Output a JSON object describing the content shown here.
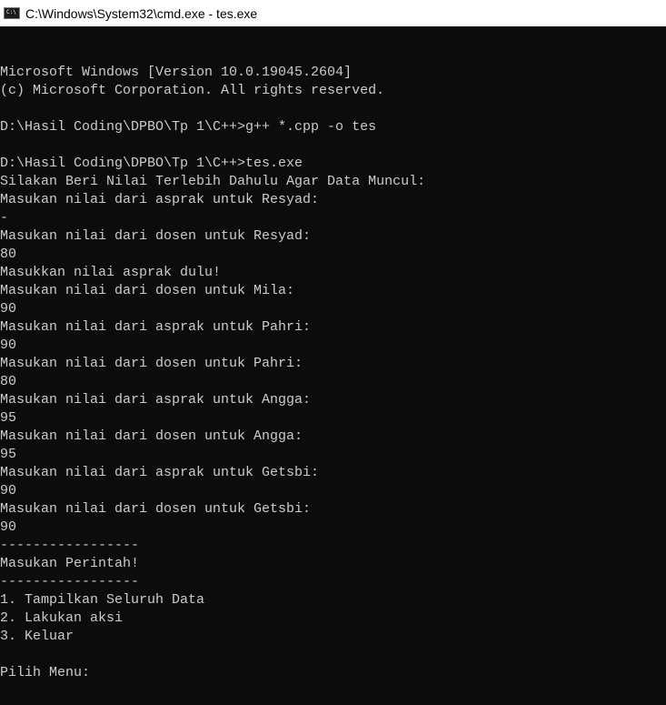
{
  "window": {
    "title": "C:\\Windows\\System32\\cmd.exe - tes.exe",
    "icon": "cmd-icon",
    "icon_text": "C:\\"
  },
  "console": {
    "lines": [
      "Microsoft Windows [Version 10.0.19045.2604]",
      "(c) Microsoft Corporation. All rights reserved.",
      "",
      "D:\\Hasil Coding\\DPBO\\Tp 1\\C++>g++ *.cpp -o tes",
      "",
      "D:\\Hasil Coding\\DPBO\\Tp 1\\C++>tes.exe",
      "Silakan Beri Nilai Terlebih Dahulu Agar Data Muncul:",
      "Masukan nilai dari asprak untuk Resyad:",
      "-",
      "Masukan nilai dari dosen untuk Resyad:",
      "80",
      "Masukkan nilai asprak dulu!",
      "Masukan nilai dari dosen untuk Mila:",
      "90",
      "Masukan nilai dari asprak untuk Pahri:",
      "90",
      "Masukan nilai dari dosen untuk Pahri:",
      "80",
      "Masukan nilai dari asprak untuk Angga:",
      "95",
      "Masukan nilai dari dosen untuk Angga:",
      "95",
      "Masukan nilai dari asprak untuk Getsbi:",
      "90",
      "Masukan nilai dari dosen untuk Getsbi:",
      "90",
      "-----------------",
      "Masukan Perintah!",
      "-----------------",
      "1. Tampilkan Seluruh Data",
      "2. Lakukan aksi",
      "3. Keluar",
      "",
      "Pilih Menu:"
    ]
  },
  "colors": {
    "background": "#0c0c0c",
    "text": "#cccccc",
    "titlebar": "#ffffff"
  }
}
